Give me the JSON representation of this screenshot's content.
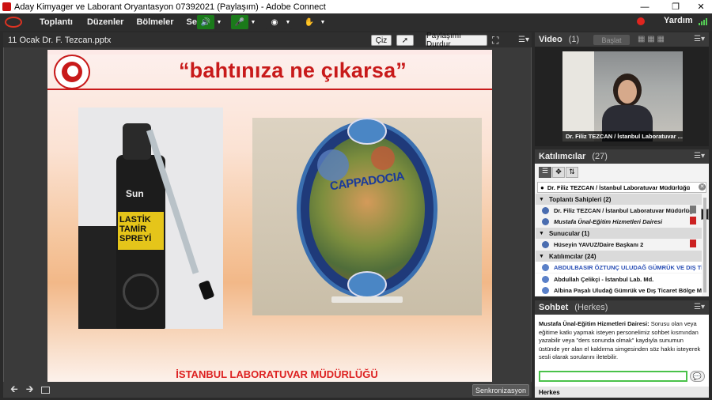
{
  "window": {
    "title": "Aday Kimyager ve Laborant Oryantasyon  07392021 (Paylaşım) - Adobe Connect"
  },
  "menu": {
    "items": [
      "Toplantı",
      "Düzenler",
      "Bölmeler",
      "Ses"
    ],
    "help": "Yardım"
  },
  "share_pod": {
    "file_name": "11 Ocak Dr. F. Tezcan.pptx",
    "draw_button": "Çiz",
    "stop_share_button": "Paylaşımı Durdur",
    "sync_button": "Senkronizasyon"
  },
  "slide": {
    "title": "“bahtınıza ne çıkarsa”",
    "footer": "İSTANBUL LABORATUVAR MÜDÜRLÜĞÜ",
    "photo1_text": {
      "brand": "Sun",
      "line1": "LASTİK",
      "line2": "TAMİR",
      "line3": "SPREYİ"
    },
    "photo2_text": "CAPPADOCIA"
  },
  "video_pod": {
    "title": "Video",
    "count": "(1)",
    "start_button": "Başlat",
    "name_label": "Dr. Filiz TEZCAN / İstanbul Laboratuvar ..."
  },
  "attendees_pod": {
    "title": "Katılımcılar",
    "count": "(27)",
    "selected": "Dr. Filiz TEZCAN / İstanbul Laboratuvar Müdürlüğü",
    "groups": [
      {
        "label": "Toplantı Sahipleri (2)",
        "members": [
          "Dr. Filiz TEZCAN / İstanbul Laboratuvar Müdürlüğü",
          "Mustafa Ünal-Eğitim Hizmetleri Dairesi"
        ]
      },
      {
        "label": "Sunucular (1)",
        "members": [
          "Hüseyin YAVUZ/Daire Başkanı 2"
        ]
      },
      {
        "label": "Katılımcılar (24)",
        "members": [
          "ABDULBASIR ÖZTUNÇ ULUDAĞ GÜMRÜK VE DIŞ TİC...",
          "Abdullah Çelikçi - İstanbul Lab. Md.",
          "Albina Paşalı Uludağ Gümrük ve Dış Ticaret Bölge Mü..."
        ]
      }
    ]
  },
  "chat_pod": {
    "title": "Sohbet",
    "audience": "(Herkes)",
    "message_author": "Mustafa Ünal-Eğitim Hizmetleri Dairesi:",
    "message_text": " Sorusu olan veya eğitime katkı yapmak isteyen personelimiz sohbet kısmından yazabilir veya \"ders sonunda olmak\" kaydıyla sunumun üstünde yer alan el kaldırma simgesinden söz hakkı isteyerek sesli olarak sorularını iletebilir.",
    "recipient": "Herkes"
  },
  "colors": {
    "accent_red": "#c81a1a",
    "chat_border": "#4ac24a",
    "status_dot": "#e0251f"
  }
}
